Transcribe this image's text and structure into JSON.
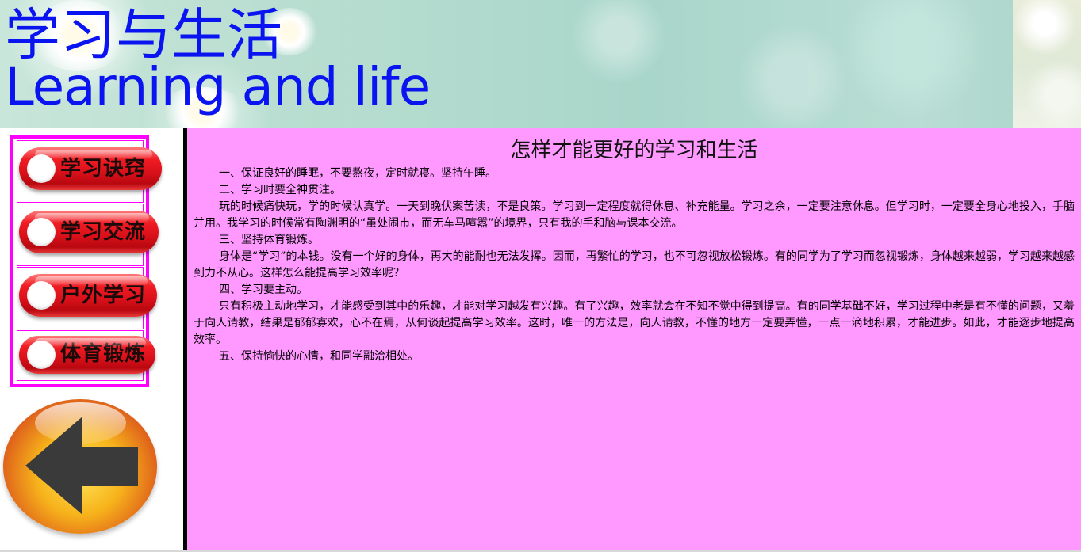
{
  "banner": {
    "title_cn": "学习与生活",
    "title_en": "Learning and life",
    "title_color": "#0a14f0"
  },
  "sidebar": {
    "menu_items": [
      {
        "label": "学习诀窍"
      },
      {
        "label": "学习交流"
      },
      {
        "label": "户外学习"
      },
      {
        "label": "体育锻炼"
      }
    ],
    "back_button": {
      "icon": "back-arrow-icon"
    },
    "border_color": "#ff00ff"
  },
  "article": {
    "title": "怎样才能更好的学习和生活",
    "background": "#ff99ff",
    "paragraphs": [
      "一、保证良好的睡眠，不要熬夜，定时就寝。坚持午睡。",
      "二、学习时要全神贯注。",
      "玩的时候痛快玩，学的时候认真学。一天到晚伏案苦读，不是良策。学习到一定程度就得休息、补充能量。学习之余，一定要注意休息。但学习时，一定要全身心地投入，手脑并用。我学习的时候常有陶渊明的“虽处闹市，而无车马喧嚣”的境界，只有我的手和脑与课本交流。",
      "三、坚持体育锻炼。",
      "身体是“学习”的本钱。没有一个好的身体，再大的能耐也无法发挥。因而，再繁忙的学习，也不可忽视放松锻炼。有的同学为了学习而忽视锻炼，身体越来越弱，学习越来越感到力不从心。这样怎么能提高学习效率呢？",
      "四、学习要主动。",
      "只有积极主动地学习，才能感受到其中的乐趣，才能对学习越发有兴趣。有了兴趣，效率就会在不知不觉中得到提高。有的同学基础不好，学习过程中老是有不懂的问题，又羞于向人请教，结果是郁郁寡欢，心不在焉，从何谈起提高学习效率。这时，唯一的方法是，向人请教，不懂的地方一定要弄懂，一点一滴地积累，才能进步。如此，才能逐步地提高效率。",
      "五、保持愉快的心情，和同学融洽相处。"
    ]
  }
}
